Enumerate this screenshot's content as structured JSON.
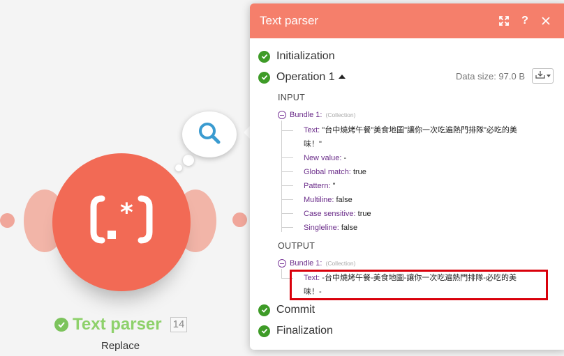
{
  "module": {
    "title": "Text parser",
    "count": "14",
    "subtitle": "Replace",
    "glyph": "(.*)",
    "color": "#f26a55"
  },
  "panel": {
    "title": "Text parser",
    "header_color": "#f57f6b",
    "sections": {
      "initialization": "Initialization",
      "operation": "Operation 1",
      "commit": "Commit",
      "finalization": "Finalization"
    },
    "data_size": "Data size: 97.0 B",
    "input_label": "INPUT",
    "output_label": "OUTPUT",
    "input_bundle": {
      "label": "Bundle 1:",
      "type": "(Collection)",
      "fields": [
        {
          "key": "Text:",
          "value": "\"台中燒烤午餐\"美食地圖\"讓你一次吃遍熱門排隊\"必吃的美",
          "value_cont": "味！\""
        },
        {
          "key": "New value:",
          "value": "-"
        },
        {
          "key": "Global match:",
          "value": "true"
        },
        {
          "key": "Pattern:",
          "value": "\""
        },
        {
          "key": "Multiline:",
          "value": "false"
        },
        {
          "key": "Case sensitive:",
          "value": "true"
        },
        {
          "key": "Singleline:",
          "value": "false"
        }
      ]
    },
    "output_bundle": {
      "label": "Bundle 1:",
      "type": "(Collection)",
      "fields": [
        {
          "key": "Text:",
          "value": "-台中燒烤午餐-美食地圖-讓你一次吃遍熱門排隊-必吃的美",
          "value_cont": "味！-"
        }
      ]
    }
  },
  "icons": {
    "search": "search-icon",
    "expand": "expand-icon",
    "help": "help-icon",
    "close": "close-icon",
    "download": "download-icon",
    "check": "check-icon"
  },
  "colors": {
    "success": "#3e9b27",
    "highlight_border": "#d9000b",
    "key_purple": "#6b2d8a"
  }
}
